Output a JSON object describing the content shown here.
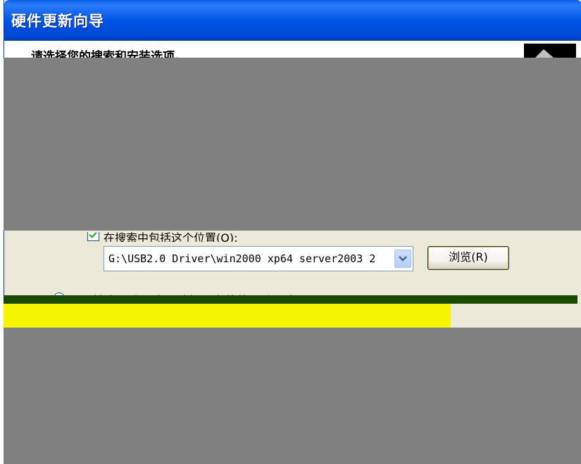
{
  "window": {
    "title": "硬件更新向导"
  },
  "header": {
    "title": "请选择您的搜索和安装选项。"
  },
  "options": {
    "include_location_label": "在搜索中包括这个位置(O):",
    "path_value": "G:\\USB2.0 Driver\\win2000 xp64 server2003 2",
    "browse_label": "浏览(R)",
    "dont_search_label": "不要搜索。我要自己选择要安装的驱动程序(D)。"
  },
  "colors": {
    "title_bar": "#0055e5",
    "dialog_bg": "#ece9d8",
    "redaction": "#808080",
    "yellow_artifact": "#f5f500"
  }
}
